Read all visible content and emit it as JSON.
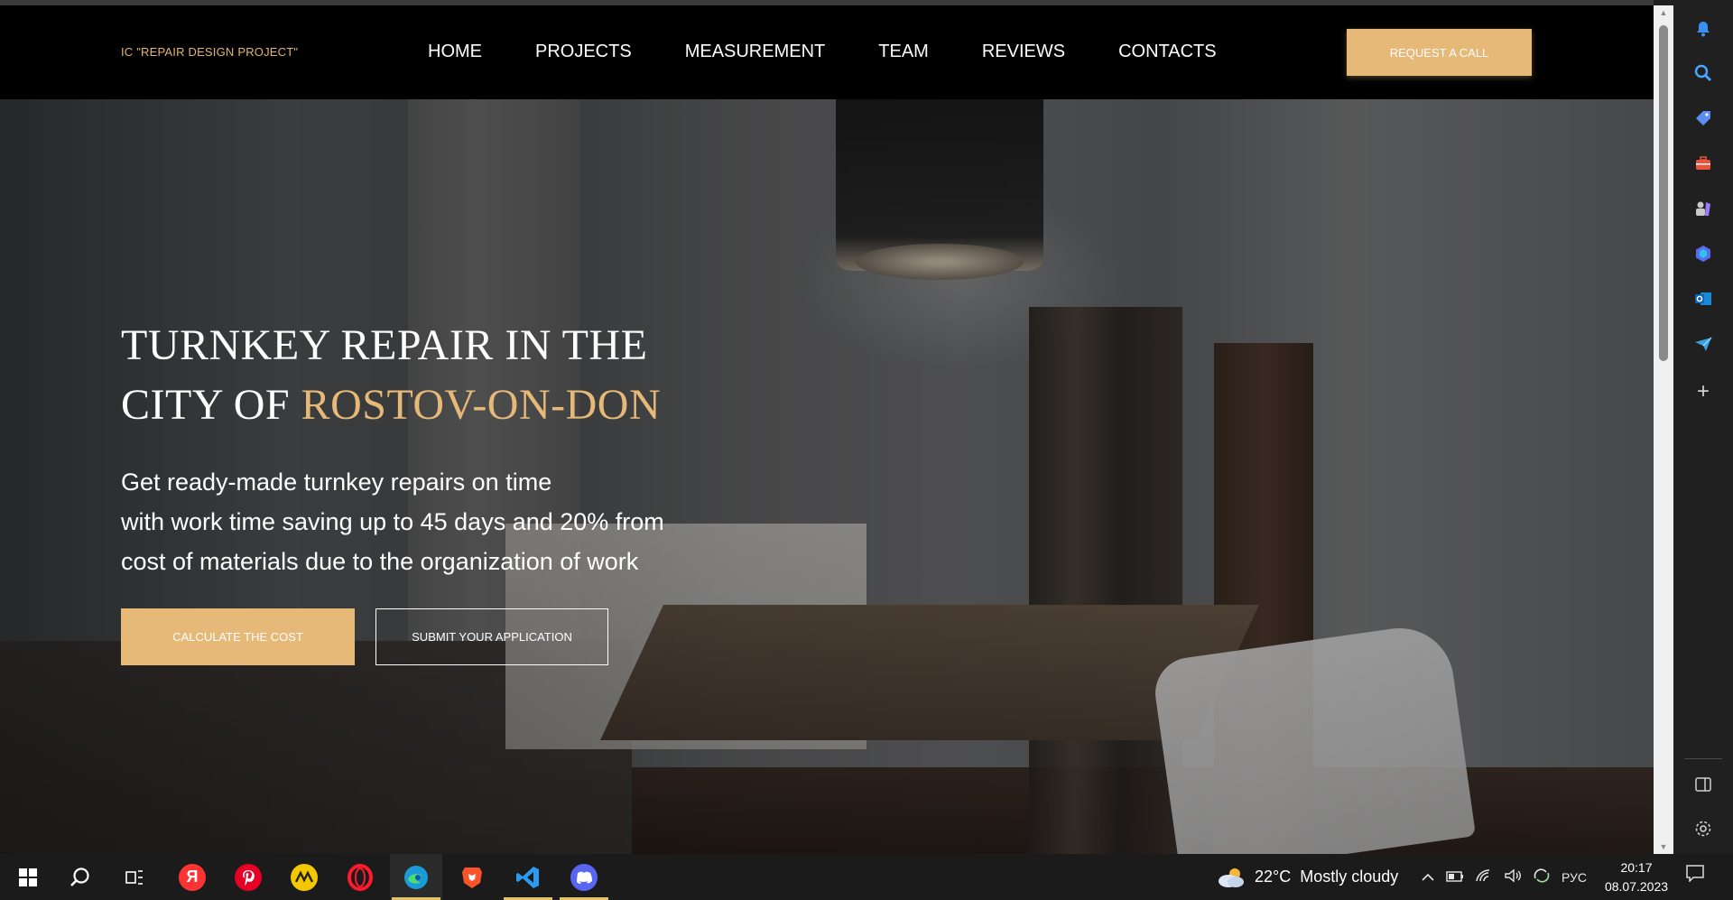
{
  "site": {
    "logo": "IC \"REPAIR DESIGN PROJECT\"",
    "nav": [
      "HOME",
      "PROJECTS",
      "MEASUREMENT",
      "TEAM",
      "REVIEWS",
      "CONTACTS"
    ],
    "request_call_label": "REQUEST A CALL"
  },
  "hero": {
    "title_line1": "TURNKEY REPAIR IN THE",
    "title_line2_prefix": "CITY OF ",
    "title_line2_accent": "ROSTOV-ON-DON",
    "text_lines": [
      "Get ready-made turnkey repairs on time",
      "with work time saving up to 45 days and 20% from",
      "cost of materials due to the organization of work"
    ],
    "calc_label": "CALCULATE THE COST",
    "submit_label": "SUBMIT YOUR APPLICATION"
  },
  "colors": {
    "accent": "#e6b978",
    "header_bg": "#000000",
    "text": "#ffffff"
  },
  "edge_sidebar": {
    "icons": [
      "bell-icon",
      "search-icon",
      "tag-icon",
      "toolbox-icon",
      "games-icon",
      "copilot-icon",
      "outlook-icon",
      "send-icon",
      "add-icon",
      "sidebar-toggle-icon",
      "settings-icon"
    ],
    "add_symbol": "+"
  },
  "taskbar": {
    "apps": [
      "windows-start",
      "search",
      "task-view",
      "yandex",
      "pinterest",
      "app-yellow",
      "opera",
      "edge",
      "brave",
      "vscode",
      "app-discord"
    ],
    "yandex_letter": "Я",
    "weather_temp": "22°C",
    "weather_text": "Mostly cloudy",
    "language": "РУС",
    "time": "20:17",
    "date": "08.07.2023"
  }
}
